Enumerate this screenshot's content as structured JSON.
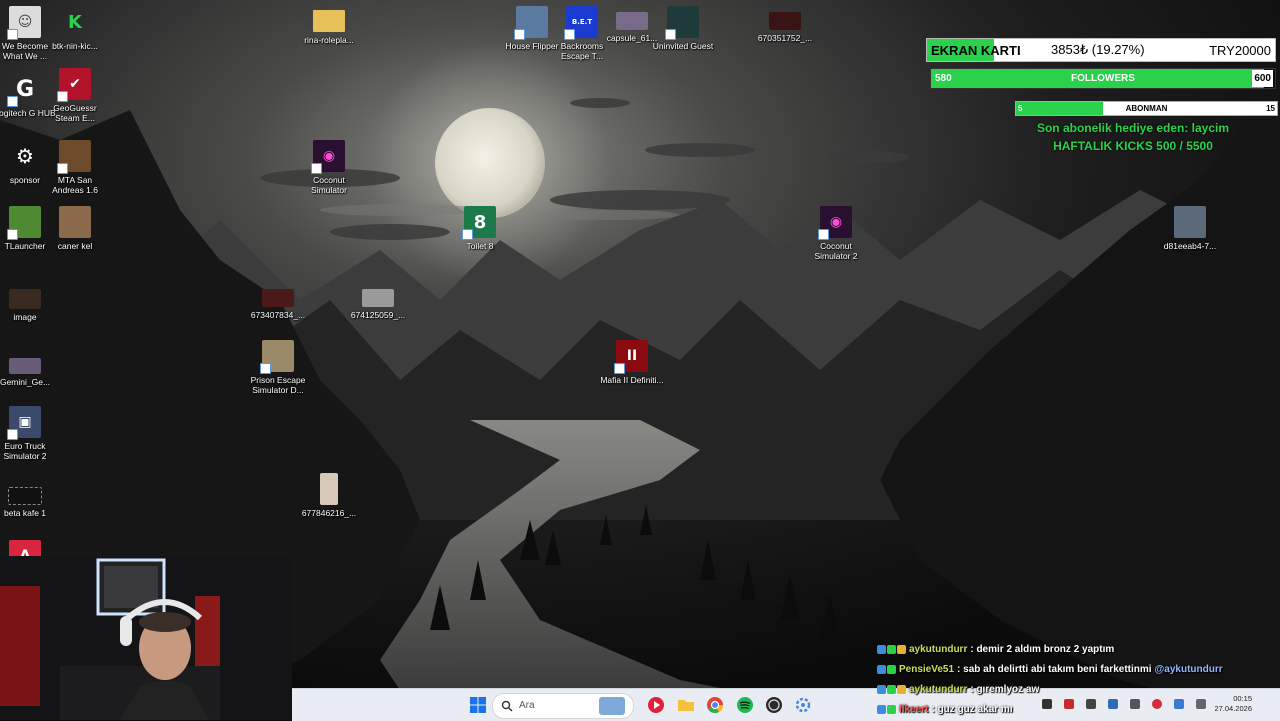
{
  "desktop": {
    "icons": [
      {
        "label": "We Become What We ..."
      },
      {
        "label": "btk-nin-kic..."
      },
      {
        "label": "rina-rolepla..."
      },
      {
        "label": "House Flipper"
      },
      {
        "label": "Backrooms Escape T..."
      },
      {
        "label": "capsule_61..."
      },
      {
        "label": "Uninvited Guest"
      },
      {
        "label": "670351752_..."
      },
      {
        "label": "Logitech G HUB"
      },
      {
        "label": "GeoGuessr Steam E..."
      },
      {
        "label": "sponsor"
      },
      {
        "label": "MTA San Andreas 1.6"
      },
      {
        "label": "Coconut Simulator"
      },
      {
        "label": "Toilet 8"
      },
      {
        "label": "Coconut Simulator 2"
      },
      {
        "label": "d81eeab4-7..."
      },
      {
        "label": "TLauncher"
      },
      {
        "label": "caner kel"
      },
      {
        "label": "673407834_..."
      },
      {
        "label": "674125059_..."
      },
      {
        "label": "image"
      },
      {
        "label": "Prison Escape Simulator D..."
      },
      {
        "label": "Mafia II Definiti..."
      },
      {
        "label": "Gemini_Ge..."
      },
      {
        "label": "Euro Truck Simulator 2"
      },
      {
        "label": "677846216_..."
      },
      {
        "label": "beta kafe 1"
      }
    ],
    "icon_glyphs": {
      "backrooms": "B.E.T",
      "toilet": "8"
    }
  },
  "overlay": {
    "ekran_karti": {
      "label": "EKRAN KARTI",
      "amount": "3853₺ (19.27%)",
      "target": "TRY20000",
      "progress": 0.1927
    },
    "followers": {
      "current": "580",
      "label": "FOLLOWERS",
      "goal": "600",
      "progress": 0.967
    },
    "abonman": {
      "current": "5",
      "label": "ABONMAN",
      "goal": "15",
      "progress": 0.333
    },
    "son_abonelik": "Son abonelik hediye eden: laycim",
    "haftalik_kicks": "HAFTALIK KICKS 500 / 5500"
  },
  "chat": [
    {
      "user": "aykutundurr",
      "text": ": demir 2 aldım bronz 2 yaptım",
      "mention": ""
    },
    {
      "user": "PensieVe51",
      "text": ": sab ah delirtti abi takım beni farkettinmi",
      "mention": "@aykutundurr"
    },
    {
      "user": "aykutundurr",
      "text": ": gıremlyoz aw",
      "mention": ""
    },
    {
      "user": "ilkeert",
      "text": ": guz guz akar mı",
      "mention": ""
    }
  ],
  "taskbar": {
    "search_placeholder": "Ara",
    "time": "00:15",
    "date": "27.04.2026"
  },
  "colors": {
    "accent_green": "#2ad14a",
    "taskbar_bg": "#e9edf3"
  }
}
